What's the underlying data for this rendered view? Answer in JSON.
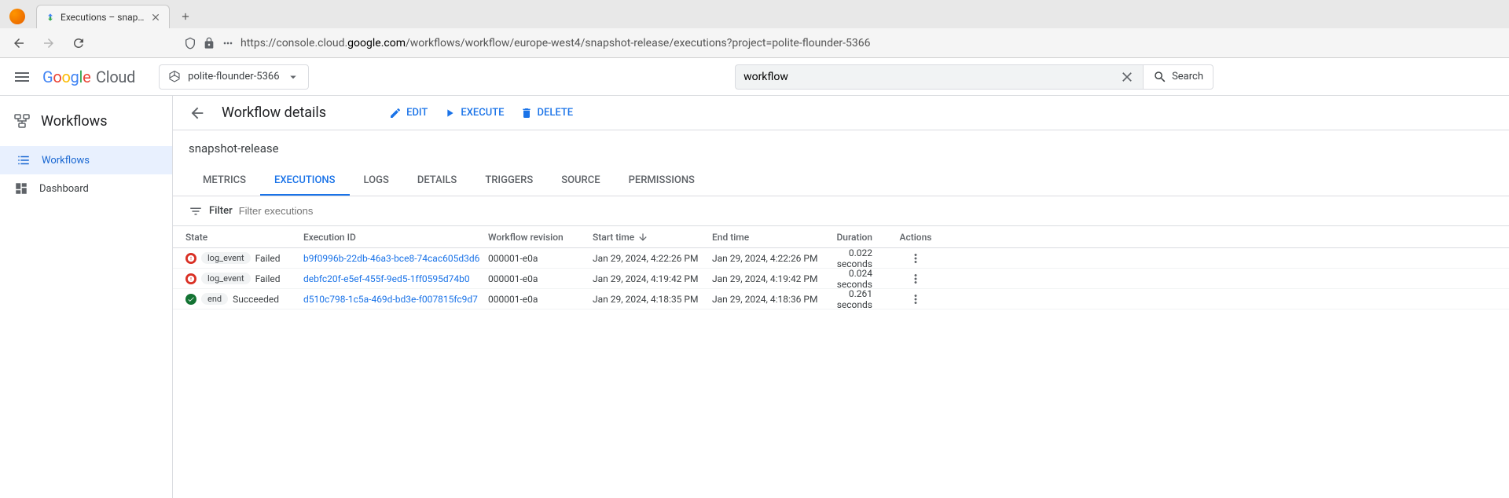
{
  "browser": {
    "tab_title": "Executions – snapshot-rel…",
    "url_prefix": "https://console.cloud.",
    "url_domain": "google.com",
    "url_path": "/workflows/workflow/europe-west4/snapshot-release/executions?project=polite-flounder-5366"
  },
  "header": {
    "logo": "Google Cloud",
    "project": "polite-flounder-5366",
    "search_value": "workflow",
    "search_btn": "Search"
  },
  "sidebar": {
    "title": "Workflows",
    "items": [
      {
        "label": "Workflows",
        "active": true
      },
      {
        "label": "Dashboard",
        "active": false
      }
    ]
  },
  "content": {
    "page_title": "Workflow details",
    "workflow_name": "snapshot-release",
    "actions": {
      "edit": "EDIT",
      "execute": "EXECUTE",
      "delete": "DELETE"
    },
    "tabs": [
      "METRICS",
      "EXECUTIONS",
      "LOGS",
      "DETAILS",
      "TRIGGERS",
      "SOURCE",
      "PERMISSIONS"
    ],
    "active_tab": "EXECUTIONS",
    "filter": {
      "label": "Filter",
      "placeholder": "Filter executions"
    },
    "columns": {
      "state": "State",
      "execution_id": "Execution ID",
      "workflow_revision": "Workflow revision",
      "start_time": "Start time",
      "end_time": "End time",
      "duration": "Duration",
      "actions": "Actions"
    },
    "rows": [
      {
        "status": "failed",
        "step": "log_event",
        "state_text": "Failed",
        "exec_id": "b9f0996b-22db-46a3-bce8-74cac605d3d6",
        "revision": "000001-e0a",
        "start": "Jan 29, 2024, 4:22:26 PM",
        "end": "Jan 29, 2024, 4:22:26 PM",
        "duration": "0.022 seconds"
      },
      {
        "status": "failed",
        "step": "log_event",
        "state_text": "Failed",
        "exec_id": "debfc20f-e5ef-455f-9ed5-1ff0595d74b0",
        "revision": "000001-e0a",
        "start": "Jan 29, 2024, 4:19:42 PM",
        "end": "Jan 29, 2024, 4:19:42 PM",
        "duration": "0.024 seconds"
      },
      {
        "status": "succeeded",
        "step": "end",
        "state_text": "Succeeded",
        "exec_id": "d510c798-1c5a-469d-bd3e-f007815fc9d7",
        "revision": "000001-e0a",
        "start": "Jan 29, 2024, 4:18:35 PM",
        "end": "Jan 29, 2024, 4:18:36 PM",
        "duration": "0.261 seconds"
      }
    ]
  }
}
